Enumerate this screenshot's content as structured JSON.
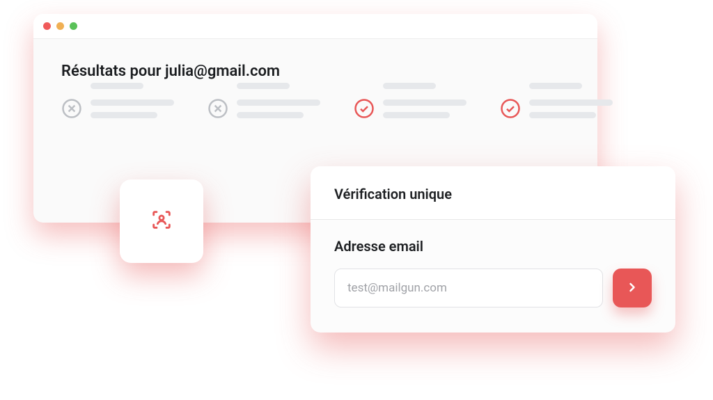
{
  "results": {
    "heading": "Résultats pour julia@gmail.com",
    "items": [
      {
        "status": "fail"
      },
      {
        "status": "fail"
      },
      {
        "status": "pass"
      },
      {
        "status": "pass"
      }
    ]
  },
  "verify": {
    "title": "Vérification unique",
    "label": "Adresse email",
    "input_placeholder": "test@mailgun.com"
  },
  "colors": {
    "accent": "#e85757",
    "neutral_icon": "#bcbfc4"
  }
}
